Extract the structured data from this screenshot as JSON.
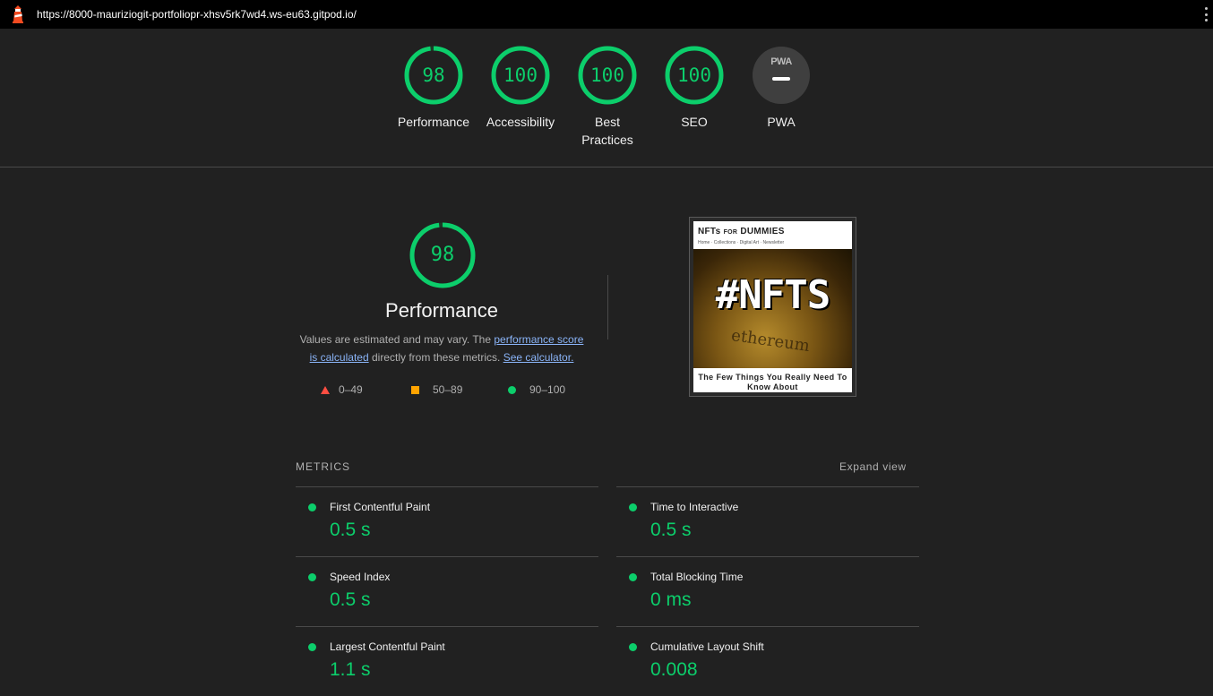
{
  "browser": {
    "url": "https://8000-mauriziogit-portfoliopr-xhsv5rk7wd4.ws-eu63.gitpod.io/"
  },
  "gauges": [
    {
      "score": "98",
      "label": "Performance"
    },
    {
      "score": "100",
      "label": "Accessibility"
    },
    {
      "score": "100",
      "label": "Best Practices"
    },
    {
      "score": "100",
      "label": "SEO"
    },
    {
      "score": "PWA",
      "label": "PWA"
    }
  ],
  "performance": {
    "score": "98",
    "title": "Performance",
    "desc_prefix": "Values are estimated and may vary. The ",
    "link_score": "performance score is calculated",
    "desc_middle": " directly from these metrics. ",
    "link_calc": "See calculator.",
    "legend": {
      "fail": "0–49",
      "average": "50–89",
      "pass": "90–100"
    }
  },
  "thumbnail": {
    "site_title": "NFTs",
    "site_title_small": "FOR",
    "site_title_end": "DUMMIES",
    "nav": "Home  ·  Collections  ·  Digital Art  ·  Newsletter",
    "hero_text": "#NFTS",
    "hero_sub": "ethereum",
    "caption": "The Few Things You Really Need To Know About"
  },
  "metrics": {
    "heading": "METRICS",
    "expand_label": "Expand view",
    "items": [
      {
        "name": "First Contentful Paint",
        "value": "0.5 s"
      },
      {
        "name": "Time to Interactive",
        "value": "0.5 s"
      },
      {
        "name": "Speed Index",
        "value": "0.5 s"
      },
      {
        "name": "Total Blocking Time",
        "value": "0 ms"
      },
      {
        "name": "Largest Contentful Paint",
        "value": "1.1 s"
      },
      {
        "name": "Cumulative Layout Shift",
        "value": "0.008"
      }
    ]
  },
  "colors": {
    "pass": "#0cce6b",
    "average": "#ffa400",
    "fail": "#ff4e42",
    "link": "#8ab4f8",
    "background": "#212121"
  }
}
